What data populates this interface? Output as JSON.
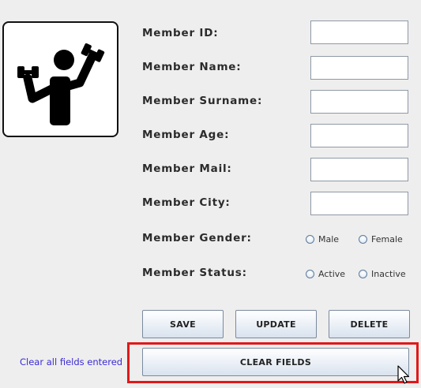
{
  "form": {
    "labels": {
      "id": "Member ID:",
      "name": "Member Name:",
      "surname": "Member Surname:",
      "age": "Member Age:",
      "mail": "Member Mail:",
      "city": "Member City:",
      "gender": "Member Gender:",
      "status": "Member Status:"
    },
    "values": {
      "id": "",
      "name": "",
      "surname": "",
      "age": "",
      "mail": "",
      "city": ""
    },
    "gender_options": [
      "Male",
      "Female"
    ],
    "status_options": [
      "Active",
      "Inactive"
    ]
  },
  "buttons": {
    "save": "SAVE",
    "update": "UPDATE",
    "delete": "DELETE",
    "clear": "CLEAR FIELDS"
  },
  "hint_text": "Clear all fields entered",
  "icons": {
    "logo": "gym-fitness-icon",
    "cursor": "mouse-cursor-icon"
  },
  "colors": {
    "background": "#eeeeee",
    "highlight": "#e01919",
    "hint": "#3b2bd3"
  }
}
